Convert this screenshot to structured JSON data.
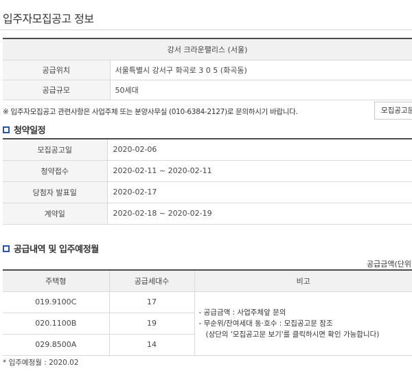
{
  "page": {
    "title": "입주자모집공고 정보"
  },
  "complex": {
    "name": "강서   크라운팰리스 (서울)",
    "rows": [
      {
        "label": "공급위치",
        "value": "서울특별시  강서구  화곡로  3 0 5 (화곡동)"
      },
      {
        "label": "공급규모",
        "value": "50세대"
      }
    ]
  },
  "notice": {
    "text": "※ 입주자모집공고 관련사항은 사업주체 또는 분양사무실 (010-6384-2127)로 문의하시기 바랍니다.",
    "button_label": "모집공고문 보기"
  },
  "schedule": {
    "heading": "청약일정",
    "rows": [
      {
        "label": "모집공고일",
        "value": "2020-02-06"
      },
      {
        "label": "청약접수",
        "value": "2020-02-11 ~ 2020-02-11"
      },
      {
        "label": "당첨자 발표일",
        "value": "2020-02-17"
      },
      {
        "label": "계약일",
        "value": "2020-02-18 ~ 2020-02-19"
      }
    ]
  },
  "supply": {
    "heading": "공급내역 및 입주예정월",
    "unit_note": "공급금액(단위:",
    "columns": [
      "주택형",
      "공급세대수",
      "비고"
    ],
    "rows": [
      {
        "type": "019.9100C",
        "count": "17"
      },
      {
        "type": "020.1100B",
        "count": "19"
      },
      {
        "type": "029.8500A",
        "count": "14"
      }
    ],
    "remarks": [
      "-  공급금액 : 사업주체앞 문의",
      "-  무순위/잔여세대 동·호수 : 모집공고문 참조",
      "   (상단의 '모집공고문 보기'를 클릭하시면 확인 가능합니다)"
    ]
  },
  "move_in": {
    "text": "* 입주예정월 : 2020.02"
  }
}
